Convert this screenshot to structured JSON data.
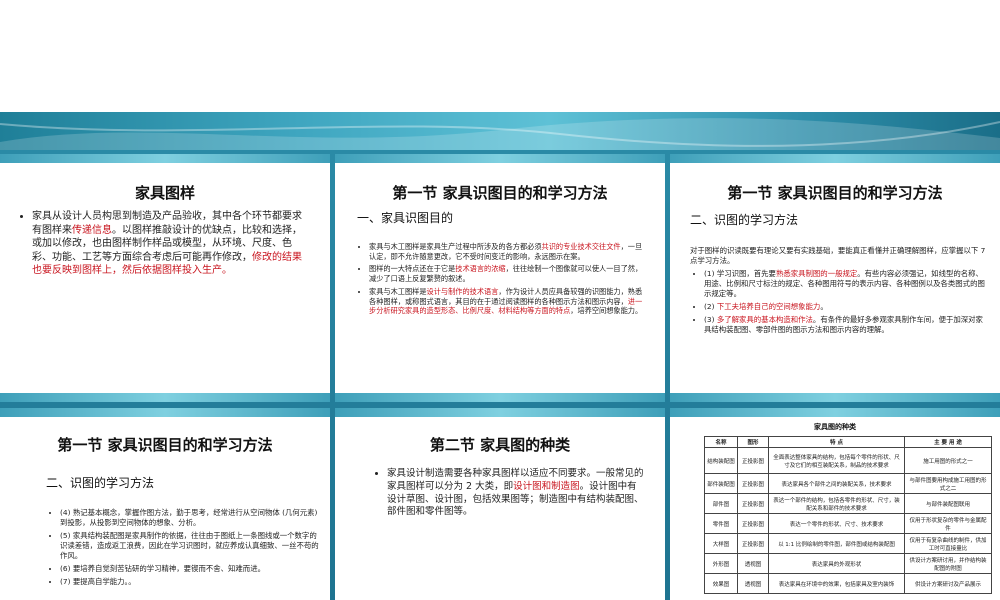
{
  "slides": {
    "s1": {
      "title": "家具图样",
      "items": [
        {
          "a": "家具从设计人员构思到制造及产品验收，其中各个环节都要求有图样来",
          "r": "传递信息",
          "b": "。以图样推敲设计的优缺点，比较和选择，或加以修改，也由图样制作样品或模型，从环境、尺度、色彩、功能、工艺等方面综合考虑后可能再作修改，",
          "r2": "修改的结果也要反映到图样上，然后依据图样投入生产。"
        }
      ]
    },
    "s2": {
      "title": "第一节  家具识图目的和学习方法",
      "subtitle": "一、家具识图目的",
      "items": [
        {
          "a": "家具与木工图样是家具生产过程中所涉及的各方都必须",
          "r": "共识的专业技术交往文件",
          "b": "，一旦认定，即不允许随意更改，它不受时间变迁的影响，永远图示在案。"
        },
        {
          "a": "图样的一大特点还在于它是",
          "r": "技术语言的浓缩",
          "b": "，往往绘制一个图像就可以使人一目了然，减少了口语上反复繁赘的叙述。"
        },
        {
          "a": "家具与木工图样是",
          "r": "设计与制作的技术语言",
          "b": "，作为设计人员应具备较强的识图能力，熟悉各种图样，或称图式语言，其目的在于通过阅读图样的各种图示方法和图示内容，",
          "r2": "进一步分析研究家具的造型形态、比例尺度、材料结构等方面的特点",
          "c": "，培养空间想象能力。"
        }
      ]
    },
    "s3": {
      "title": "第一节  家具识图目的和学习方法",
      "subtitle": "二、识图的学习方法",
      "intro": "对于图样的识读既要有理论又要有实践基础，要能真正看懂并正确理解图样，应掌握以下 7 点学习方法。",
      "items": [
        {
          "a": "(1) 学习识图，首先要",
          "r": "熟悉家具制图的一般规定",
          "b": "。有些内容必须强记，如线型的名称、用途、比例和尺寸标注的规定、各种图用符号的表示内容、各种图例以及各类图式的图示规定等。"
        },
        {
          "a": "(2) ",
          "r": "下工夫培养自己的空间想象能力",
          "b": "。"
        },
        {
          "a": "(3) ",
          "r": "多了解家具的基本构造和作法",
          "b": "。有条件的最好多参观家具制作车间，便于加深对家具结构装配图、零部件图的图示方法和图示内容的理解。"
        }
      ]
    },
    "s4": {
      "title": "第一节  家具识图目的和学习方法",
      "subtitle": "二、识图的学习方法",
      "items": [
        "(4) 熟记基本概念，掌握作图方法，勤于思考，经常进行从空间物体 (几何元素) 到投影，从投影到空间物体的想象、分析。",
        "(5) 家具结构装配图是家具制作的依据，往往由于图纸上一条图线或一个数字的识读差错，造成返工浪费，因此在学习识图时，就应养成认真细致、一丝不苟的作风。",
        "(6) 要培养自觉刻苦钻研的学习精神，要锲而不舍、知难而进。",
        "(7) 要提高自学能力。。"
      ]
    },
    "s5": {
      "title": "第二节  家具图的种类",
      "items": [
        {
          "a": "家具设计制造需要各种家具图样以适应不同要求。一般常见的家具图样可以分为 2 大类，即",
          "r": "设计图和制造图",
          "b": "。设计图中有设计草图、设计图，包括效果图等；制造图中有结构装配图、部件图和零件图等。"
        }
      ]
    },
    "s6": {
      "table_title": "家具图的种类",
      "headers": [
        "名称",
        "图形",
        "特    点",
        "主 要 用 途"
      ],
      "rows": [
        [
          "结构装配图",
          "正投影图",
          "全面表达整体家具的结构，包括每个零件的形状、尺寸及它们的相互装配关系，制品的技术要求",
          "施工用图的形式之一"
        ],
        [
          "部件装配图",
          "正投影图",
          "表达家具各个部件之间的装配关系，技术要求",
          "与部件图要用构成施工用图的形式之二"
        ],
        [
          "部件图",
          "正投影图",
          "表达一个部件的结构，包括各零件的形状、尺寸，装配关系和部件的技术要求",
          "与部件装配图联用"
        ],
        [
          "零件图",
          "正投影图",
          "表达一个零件的形状、尺寸、技术要求",
          "仅用于形状复杂的零件与金属配件"
        ],
        [
          "大样图",
          "正投影图",
          "以 1:1 比例绘制的零件图，部件图或结构装配图",
          "仅用于有复杂曲线的制件，供加工时可直接量比"
        ],
        [
          "外形图",
          "透视图",
          "表达家具的外观形状",
          "供设计方案研讨用，并作结构装配图的附图"
        ],
        [
          "效果图",
          "透视图",
          "表达家具在环境中的效果，包括家具及室内装饰",
          "供设计方案研讨及产品展示"
        ]
      ]
    }
  }
}
